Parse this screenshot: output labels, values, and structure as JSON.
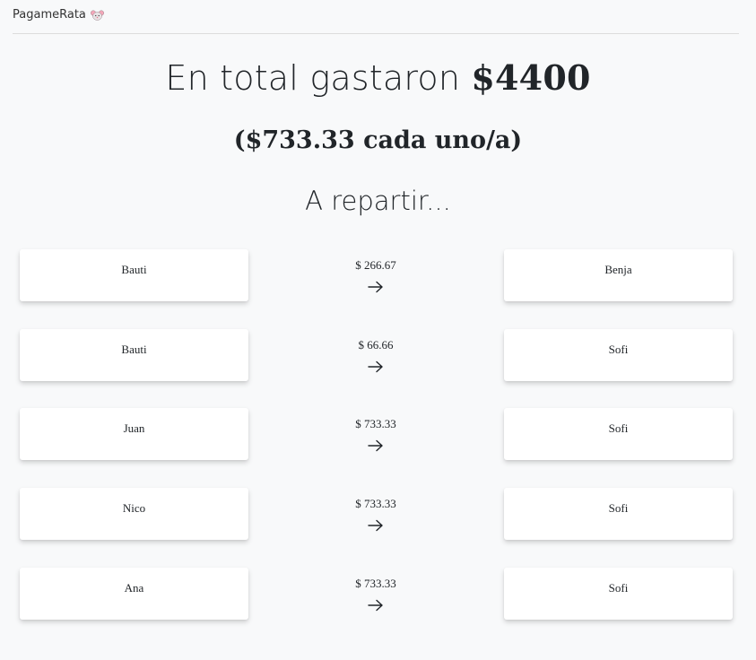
{
  "brand": {
    "name": "PagameRata",
    "emoji_icon": "mouse-face-icon"
  },
  "summary": {
    "total_prefix": "En total gastaron ",
    "total_amount": "$4400",
    "per_person": "($733.33 cada uno/a)",
    "section_title": "A repartir..."
  },
  "transfers": [
    {
      "from": "Bauti",
      "amount": "$ 266.67",
      "to": "Benja"
    },
    {
      "from": "Bauti",
      "amount": "$ 66.66",
      "to": "Sofi"
    },
    {
      "from": "Juan",
      "amount": "$ 733.33",
      "to": "Sofi"
    },
    {
      "from": "Nico",
      "amount": "$ 733.33",
      "to": "Sofi"
    },
    {
      "from": "Ana",
      "amount": "$ 733.33",
      "to": "Sofi"
    }
  ],
  "icons": {
    "arrow": "arrow-right-icon"
  }
}
